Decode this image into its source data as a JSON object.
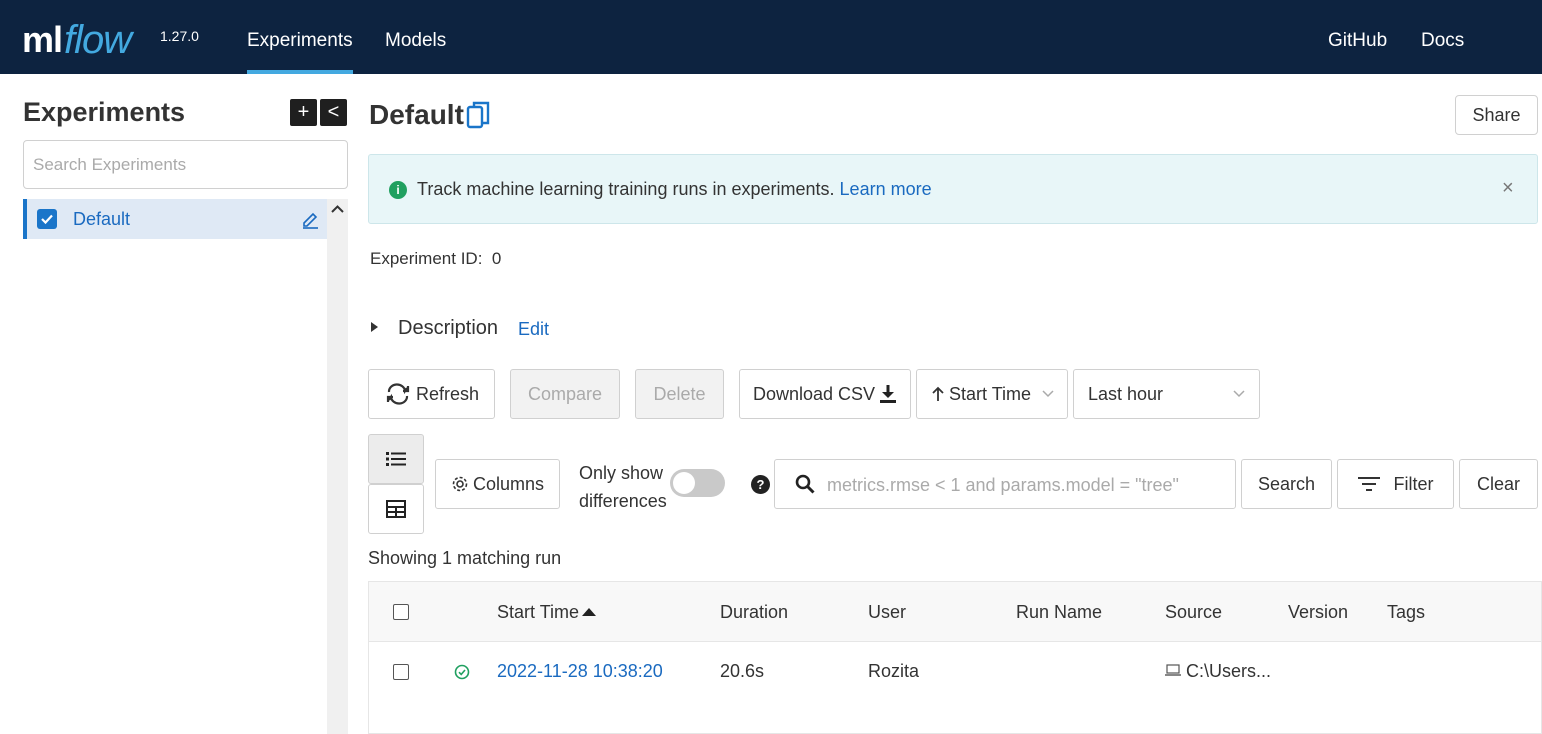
{
  "header": {
    "logo_ml": "ml",
    "logo_flow": "flow",
    "version": "1.27.0",
    "tabs": [
      {
        "label": "Experiments",
        "active": true
      },
      {
        "label": "Models",
        "active": false
      }
    ],
    "links": [
      {
        "label": "GitHub"
      },
      {
        "label": "Docs"
      }
    ]
  },
  "sidebar": {
    "title": "Experiments",
    "add_label": "+",
    "collapse_label": "<",
    "search_placeholder": "Search Experiments",
    "items": [
      {
        "label": "Default",
        "checked": true
      }
    ]
  },
  "main": {
    "title": "Default",
    "share_label": "Share",
    "banner": {
      "icon": "i",
      "text": "Track machine learning training runs in experiments.",
      "link": "Learn more",
      "close": "×"
    },
    "experiment_id_label": "Experiment ID:",
    "experiment_id_value": "0",
    "description_label": "Description",
    "edit_label": "Edit",
    "toolbar": {
      "refresh_label": "Refresh",
      "compare_label": "Compare",
      "delete_label": "Delete",
      "download_label": "Download CSV",
      "sort_label": "Start Time",
      "time_label": "Last hour",
      "columns_label": "Columns",
      "only_show_line1": "Only show",
      "only_show_line2": "differences",
      "help": "?",
      "query_placeholder": "metrics.rmse < 1 and params.model = \"tree\"",
      "search_label": "Search",
      "filter_label": "Filter",
      "clear_label": "Clear"
    },
    "showing_text": "Showing 1 matching run",
    "table": {
      "columns": [
        "Start Time",
        "Duration",
        "User",
        "Run Name",
        "Source",
        "Version",
        "Tags"
      ],
      "rows": [
        {
          "start_time": "2022-11-28 10:38:20",
          "duration": "20.6s",
          "user": "Rozita",
          "run_name": "",
          "source": "C:\\Users...",
          "version": "",
          "tags": "",
          "status": "finished"
        }
      ]
    }
  },
  "colors": {
    "header_bg": "#0d2340",
    "accent": "#43a9e0",
    "link": "#1a6ac0",
    "success": "#20a060"
  }
}
